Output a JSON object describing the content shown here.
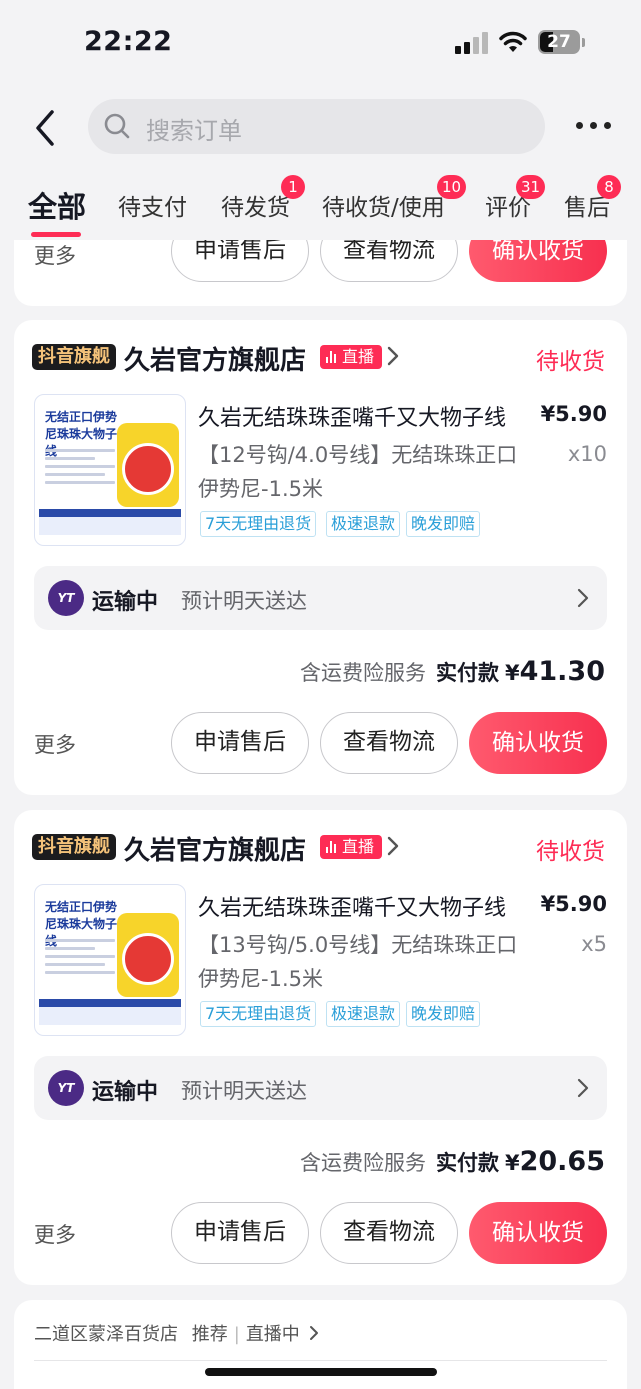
{
  "status_bar": {
    "time": "22:22",
    "battery": "27"
  },
  "header": {
    "search_placeholder": "搜索订单"
  },
  "tabs": [
    {
      "label": "全部",
      "badge": ""
    },
    {
      "label": "待支付",
      "badge": ""
    },
    {
      "label": "待发货",
      "badge": "1"
    },
    {
      "label": "待收货/使用",
      "badge": "10"
    },
    {
      "label": "评价",
      "badge": "31"
    },
    {
      "label": "售后",
      "badge": "8"
    }
  ],
  "buttons": {
    "more": "更多",
    "after_sale": "申请售后",
    "logistics": "查看物流",
    "confirm": "确认收货"
  },
  "orders": [
    {
      "brand_tag": "抖音旗舰",
      "shop": "久岩官方旗舰店",
      "live": "直播",
      "status": "待收货",
      "product_title": "久岩无结珠珠歪嘴千又大物子线",
      "price": "¥5.90",
      "spec": "【12号钩/4.0号线】无结珠珠正口伊势尼-1.5米",
      "qty": "x10",
      "thumb_title": "无结正口伊势尼珠珠大物子线",
      "tags": [
        "7天无理由退货",
        "极速退款",
        "晚发即赔"
      ],
      "logistics_status": "运输中",
      "logistics_desc": "预计明天送达",
      "insurance": "含运费险服务",
      "paid_label": "实付款",
      "currency": "¥",
      "paid_amount": "41.30"
    },
    {
      "brand_tag": "抖音旗舰",
      "shop": "久岩官方旗舰店",
      "live": "直播",
      "status": "待收货",
      "product_title": "久岩无结珠珠歪嘴千又大物子线",
      "price": "¥5.90",
      "spec": "【13号钩/5.0号线】无结珠珠正口伊势尼-1.5米",
      "qty": "x5",
      "thumb_title": "无结正口伊势尼珠珠大物子线",
      "tags": [
        "7天无理由退货",
        "极速退款",
        "晚发即赔"
      ],
      "logistics_status": "运输中",
      "logistics_desc": "预计明天送达",
      "insurance": "含运费险服务",
      "paid_label": "实付款",
      "currency": "¥",
      "paid_amount": "20.65"
    }
  ],
  "recommend": {
    "shop": "二道区蒙泽百货店",
    "label": "推荐",
    "live": "直播中"
  },
  "icons": {
    "back": "chevron-left-icon",
    "search": "search-icon",
    "more": "more-dots-icon",
    "arrow": "chevron-right-icon",
    "courier": "yto-logo-icon"
  },
  "colors": {
    "accent": "#fe2c55",
    "service_tag": "#2a9fd8",
    "background": "#f3f3f5"
  }
}
